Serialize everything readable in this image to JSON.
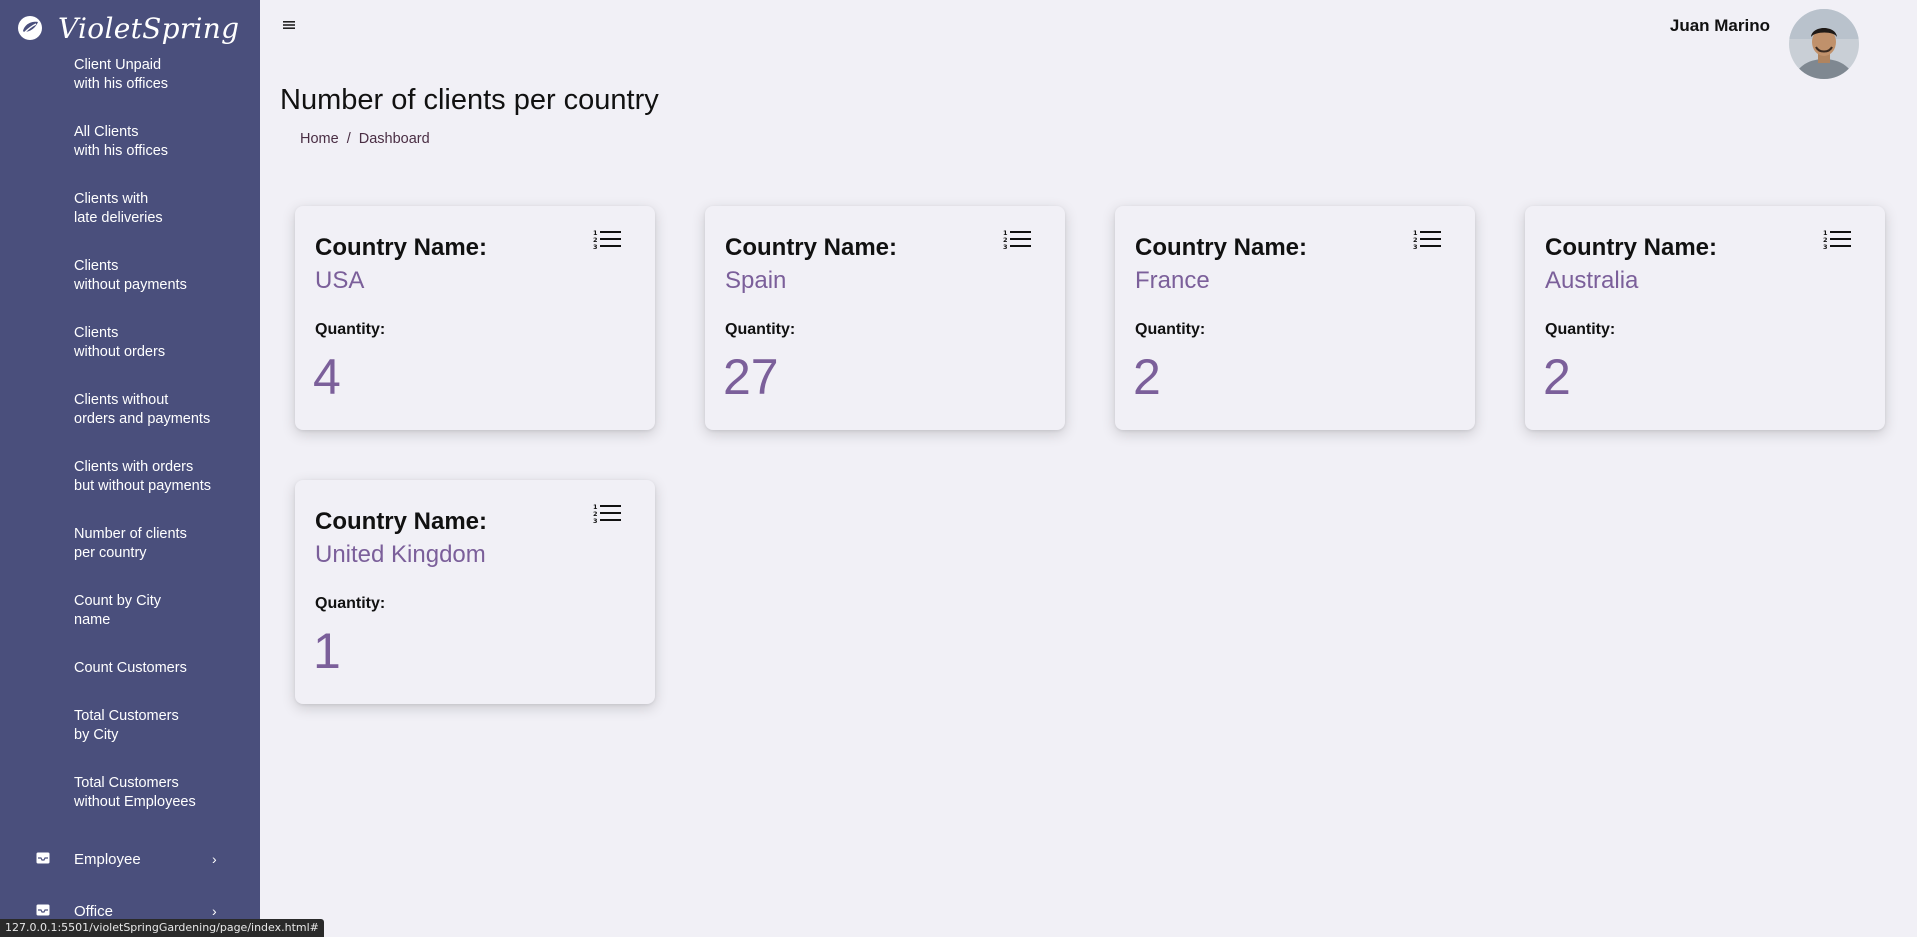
{
  "brand": {
    "name": "VioletSpring"
  },
  "sidebar": {
    "items": [
      {
        "line1": "Client Unpaid",
        "line2": "with his offices"
      },
      {
        "line1": "All Clients",
        "line2": "with his offices"
      },
      {
        "line1": "Clients with",
        "line2": "late deliveries"
      },
      {
        "line1": "Clients",
        "line2": "without payments"
      },
      {
        "line1": "Clients",
        "line2": "without orders"
      },
      {
        "line1": "Clients without",
        "line2": "orders and payments"
      },
      {
        "line1": "Clients with orders",
        "line2": "but without payments"
      },
      {
        "line1": "Number of clients",
        "line2": "per country"
      },
      {
        "line1": "Count by City",
        "line2": "name"
      },
      {
        "line1": "Count Customers",
        "line2": ""
      },
      {
        "line1": "Total Customers",
        "line2": "by City"
      },
      {
        "line1": "Total Customers",
        "line2": "without Employees"
      }
    ],
    "sections": [
      {
        "label": "Employee",
        "icon": "inbox-icon",
        "chevron": "›"
      },
      {
        "label": "Office",
        "icon": "inbox-icon",
        "chevron": "›"
      }
    ]
  },
  "header": {
    "user_name": "Juan Marino"
  },
  "page": {
    "title": "Number of clients per country",
    "breadcrumb": {
      "home": "Home",
      "separator": "/",
      "current": "Dashboard"
    }
  },
  "cards": [
    {
      "label": "Country Name:",
      "country": "USA",
      "quantity_label": "Quantity:",
      "quantity": "4"
    },
    {
      "label": "Country Name:",
      "country": "Spain",
      "quantity_label": "Quantity:",
      "quantity": "27"
    },
    {
      "label": "Country Name:",
      "country": "France",
      "quantity_label": "Quantity:",
      "quantity": "2"
    },
    {
      "label": "Country Name:",
      "country": "Australia",
      "quantity_label": "Quantity:",
      "quantity": "2"
    },
    {
      "label": "Country Name:",
      "country": "United Kingdom",
      "quantity_label": "Quantity:",
      "quantity": "1"
    }
  ],
  "status_bar": {
    "url": "127.0.0.1:5501/violetSpringGardening/page/index.html#"
  },
  "colors": {
    "sidebar_bg": "#4a4f7c",
    "page_bg": "#f1f0f6",
    "accent": "#7b5f9a"
  }
}
